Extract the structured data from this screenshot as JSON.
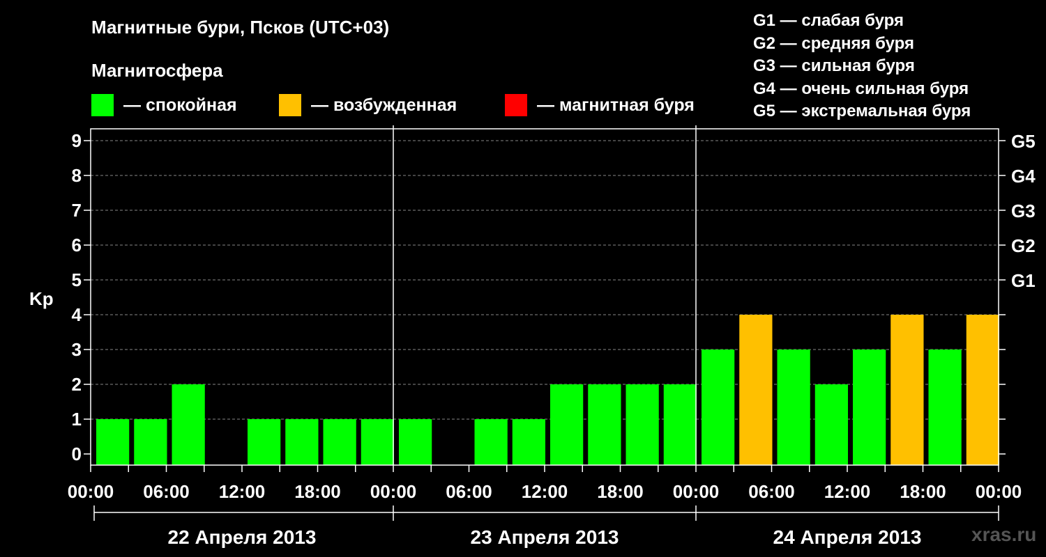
{
  "title": "Магнитные бури, Псков (UTC+03)",
  "magnetosphere_label": "Магнитосфера",
  "legend": [
    {
      "color": "#00ff00",
      "label": "— спокойная"
    },
    {
      "color": "#ffc000",
      "label": "— возбужденная"
    },
    {
      "color": "#ff0000",
      "label": "— магнитная буря"
    }
  ],
  "g_scale": [
    "G1 — слабая буря",
    "G2 — средняя буря",
    "G3 — сильная буря",
    "G4 — очень сильная буря",
    "G5 — экстремальная буря"
  ],
  "watermark": "xras.ru",
  "colors": {
    "quiet": "#00ff00",
    "active": "#ffc000",
    "storm": "#ff0000",
    "background": "#000000",
    "grid": "#888888"
  },
  "chart_data": {
    "type": "bar",
    "ylabel": "Kp",
    "ylim": [
      0,
      9
    ],
    "yticks": [
      "0",
      "1",
      "2",
      "3",
      "4",
      "5",
      "6",
      "7",
      "8",
      "9"
    ],
    "right_ticks": [
      {
        "value": 5,
        "label": "G1"
      },
      {
        "value": 6,
        "label": "G2"
      },
      {
        "value": 7,
        "label": "G3"
      },
      {
        "value": 8,
        "label": "G4"
      },
      {
        "value": 9,
        "label": "G5"
      }
    ],
    "grid": "horizontal dashed",
    "interval_hours": 3,
    "xtick_labels": [
      "00:00",
      "06:00",
      "12:00",
      "18:00",
      "00:00",
      "06:00",
      "12:00",
      "18:00",
      "00:00",
      "06:00",
      "12:00",
      "18:00",
      "00:00"
    ],
    "days": [
      "22 Апреля 2013",
      "23 Апреля 2013",
      "24 Апреля 2013"
    ],
    "values": [
      1,
      1,
      2,
      0,
      1,
      1,
      1,
      1,
      1,
      0,
      1,
      1,
      2,
      2,
      2,
      2,
      3,
      4,
      3,
      2,
      3,
      4,
      3,
      4
    ]
  }
}
